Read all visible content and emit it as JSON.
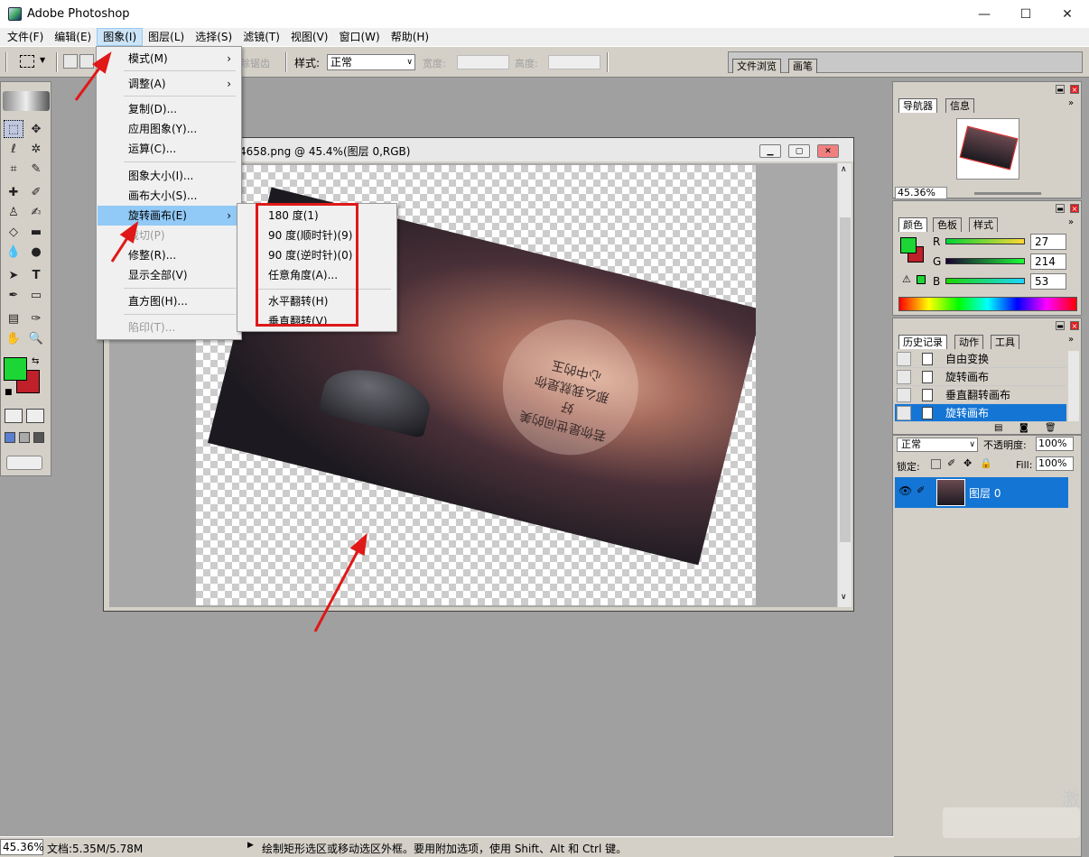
{
  "app": {
    "title": "Adobe Photoshop"
  },
  "window_controls": {
    "minimize": "—",
    "maximize": "☐",
    "close": "✕"
  },
  "menubar": [
    "文件(F)",
    "编辑(E)",
    "图象(I)",
    "图层(L)",
    "选择(S)",
    "滤镜(T)",
    "视图(V)",
    "窗口(W)",
    "帮助(H)"
  ],
  "options_bar": {
    "antialias_label": "除锯齿",
    "style_label": "样式:",
    "style_value": "正常",
    "width_label": "宽度:",
    "height_label": "高度:"
  },
  "palette_well": {
    "tabs": [
      "文件浏览",
      "画笔"
    ]
  },
  "image_menu": {
    "items": [
      {
        "label": "模式(M)",
        "submenu": true,
        "disabled": false
      },
      {
        "label": "调整(A)",
        "submenu": true,
        "disabled": false
      },
      {
        "label": "复制(D)...",
        "submenu": false,
        "disabled": false
      },
      {
        "label": "应用图象(Y)...",
        "submenu": false,
        "disabled": false
      },
      {
        "label": "运算(C)...",
        "submenu": false,
        "disabled": false
      },
      {
        "label": "图象大小(I)...",
        "submenu": false,
        "disabled": false
      },
      {
        "label": "画布大小(S)...",
        "submenu": false,
        "disabled": false
      },
      {
        "label": "旋转画布(E)",
        "submenu": true,
        "disabled": false,
        "highlighted": true
      },
      {
        "label": "裁切(P)",
        "submenu": false,
        "disabled": true
      },
      {
        "label": "修整(R)...",
        "submenu": false,
        "disabled": false
      },
      {
        "label": "显示全部(V)",
        "submenu": false,
        "disabled": false
      },
      {
        "label": "直方图(H)...",
        "submenu": false,
        "disabled": false
      },
      {
        "label": "陷印(T)...",
        "submenu": false,
        "disabled": true
      }
    ]
  },
  "rotate_submenu": {
    "items": [
      "180 度(1)",
      "90 度(顺时针)(9)",
      "90 度(逆时针)(0)",
      "任意角度(A)...",
      "水平翻转(H)",
      "垂直翻转(V)"
    ]
  },
  "document": {
    "title": "4658.png @ 45.4%(图层 0,RGB)",
    "photo_text": "若你是世间的美好\n那么我就是你\n心中的玉"
  },
  "navigator": {
    "tabs": [
      "导航器",
      "信息"
    ],
    "zoom": "45.36%"
  },
  "color_panel": {
    "tabs": [
      "颜色",
      "色板",
      "样式"
    ],
    "r_label": "R",
    "g_label": "G",
    "b_label": "B",
    "r": "27",
    "g": "214",
    "b": "53",
    "fg_color": "#1bd635",
    "bg_color": "#c0202a"
  },
  "history_panel": {
    "tabs": [
      "历史记录",
      "动作",
      "工具"
    ],
    "items": [
      "自由变换",
      "旋转画布",
      "垂直翻转画布",
      "旋转画布"
    ]
  },
  "layers_panel": {
    "blend_mode": "正常",
    "opacity_label": "不透明度:",
    "opacity_value": "100%",
    "lock_label": "锁定:",
    "fill_label": "Fill:",
    "fill_value": "100%",
    "layer_name": "图层 0"
  },
  "statusbar": {
    "zoom": "45.36%",
    "doc_size": "文档:5.35M/5.78M",
    "hint": "绘制矩形选区或移动选区外框。要用附加选项，使用 Shift、Alt 和 Ctrl 键。"
  },
  "watermark": {
    "text": "激"
  }
}
